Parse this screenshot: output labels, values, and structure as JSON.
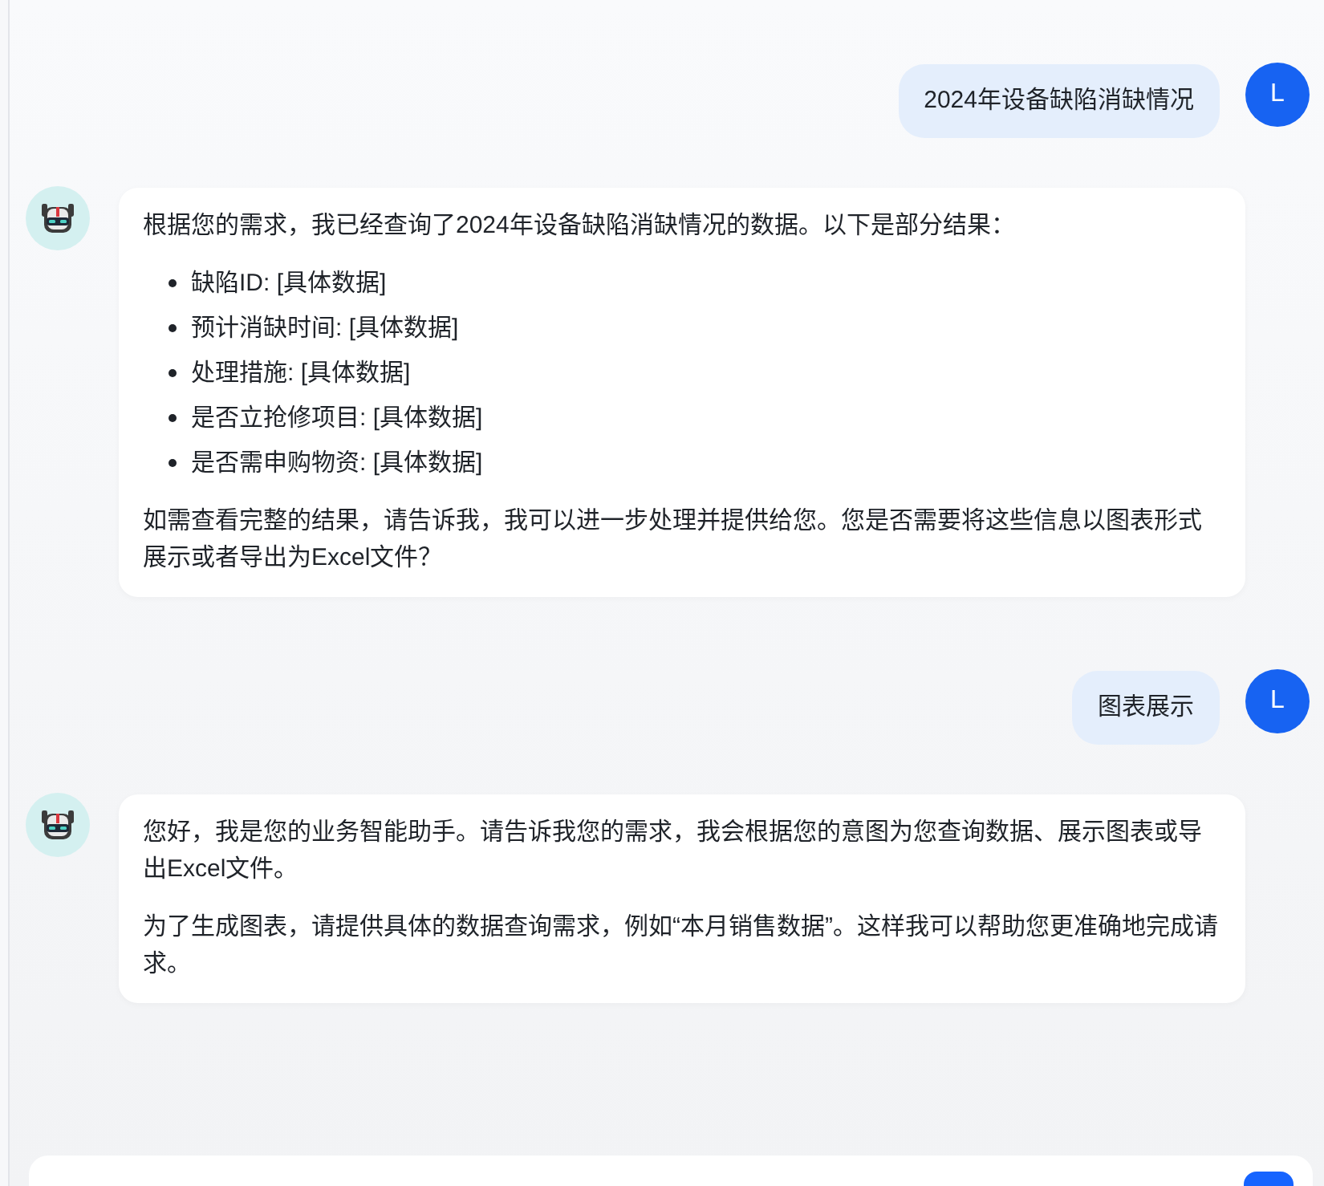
{
  "messages": [
    {
      "kind": "user",
      "avatar": "L",
      "text": "2024年设备缺陷消缺情况"
    },
    {
      "kind": "assistant",
      "blocks": [
        {
          "kind": "paragraph",
          "text": "根据您的需求，我已经查询了2024年设备缺陷消缺情况的数据。以下是部分结果："
        },
        {
          "kind": "list",
          "items": [
            "缺陷ID: [具体数据]",
            "预计消缺时间: [具体数据]",
            "处理措施: [具体数据]",
            "是否立抢修项目: [具体数据]",
            "是否需申购物资: [具体数据]"
          ]
        },
        {
          "kind": "paragraph",
          "text": "如需查看完整的结果，请告诉我，我可以进一步处理并提供给您。您是否需要将这些信息以图表形式展示或者导出为Excel文件？"
        }
      ]
    },
    {
      "kind": "user",
      "avatar": "L",
      "text": "图表展示"
    },
    {
      "kind": "assistant",
      "blocks": [
        {
          "kind": "paragraph",
          "text": "您好，我是您的业务智能助手。请告诉我您的需求，我会根据您的意图为您查询数据、展示图表或导出Excel文件。"
        },
        {
          "kind": "paragraph",
          "text": "为了生成图表，请提供具体的数据查询需求，例如“本月销售数据”。这样我可以帮助您更准确地完成请求。"
        }
      ]
    }
  ]
}
